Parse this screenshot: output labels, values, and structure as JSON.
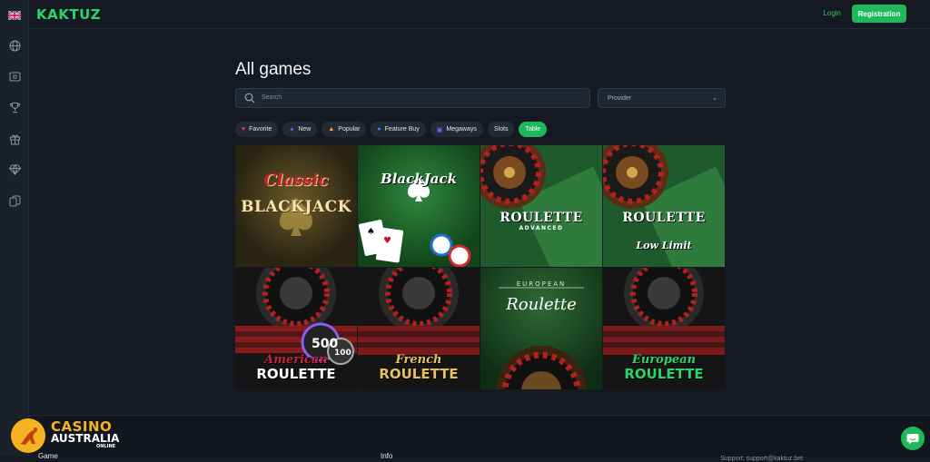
{
  "header": {
    "logo": "KAKTUZ",
    "login": "Login",
    "registration": "Registration"
  },
  "sidebar": {
    "icons": [
      "uk-flag-icon",
      "globe-icon",
      "ticket-icon",
      "trophy-icon",
      "gift-icon",
      "diamond-icon",
      "cards-icon"
    ]
  },
  "main": {
    "title": "All games",
    "search_placeholder": "Search",
    "provider_placeholder": "Provider",
    "chips": [
      {
        "label": "Favorite",
        "icon": "heart-icon",
        "active": false
      },
      {
        "label": "New",
        "icon": "lightning-icon",
        "active": false
      },
      {
        "label": "Popular",
        "icon": "thumbs-up-icon",
        "active": false
      },
      {
        "label": "Feature Buy",
        "icon": "feature-buy-icon",
        "active": false
      },
      {
        "label": "Megaways",
        "icon": "megaways-icon",
        "active": false
      },
      {
        "label": "Slots",
        "icon": "",
        "active": false
      },
      {
        "label": "Table",
        "icon": "",
        "active": true
      }
    ],
    "games": [
      {
        "line1": "Classic",
        "line2": "BLACKJACK",
        "kind": "classic-blackjack"
      },
      {
        "line1": "BlackJack",
        "line2": "",
        "kind": "blackjack"
      },
      {
        "line1": "ROULETTE",
        "line2": "ADVANCED",
        "kind": "roulette-advanced"
      },
      {
        "line1": "ROULETTE",
        "line2": "Low Limit",
        "kind": "roulette-low-limit"
      },
      {
        "line1": "American",
        "line2": "ROULETTE",
        "kind": "american-roulette"
      },
      {
        "line1": "French",
        "line2": "ROULETTE",
        "kind": "french-roulette"
      },
      {
        "line1": "EUROPEAN",
        "line2": "Roulette",
        "kind": "european-roulette-classic"
      },
      {
        "line1": "European",
        "line2": "ROULETTE",
        "kind": "european-roulette"
      }
    ]
  },
  "footer": {
    "col1": "Game",
    "col2": "Info",
    "support": "Support: support@kaktuz.bet"
  },
  "watermark": {
    "line1": "CASINO",
    "line2": "AUSTRALIA",
    "line3": "ONLINE"
  },
  "colors": {
    "accent": "#1fb85a",
    "background": "#151a22"
  }
}
